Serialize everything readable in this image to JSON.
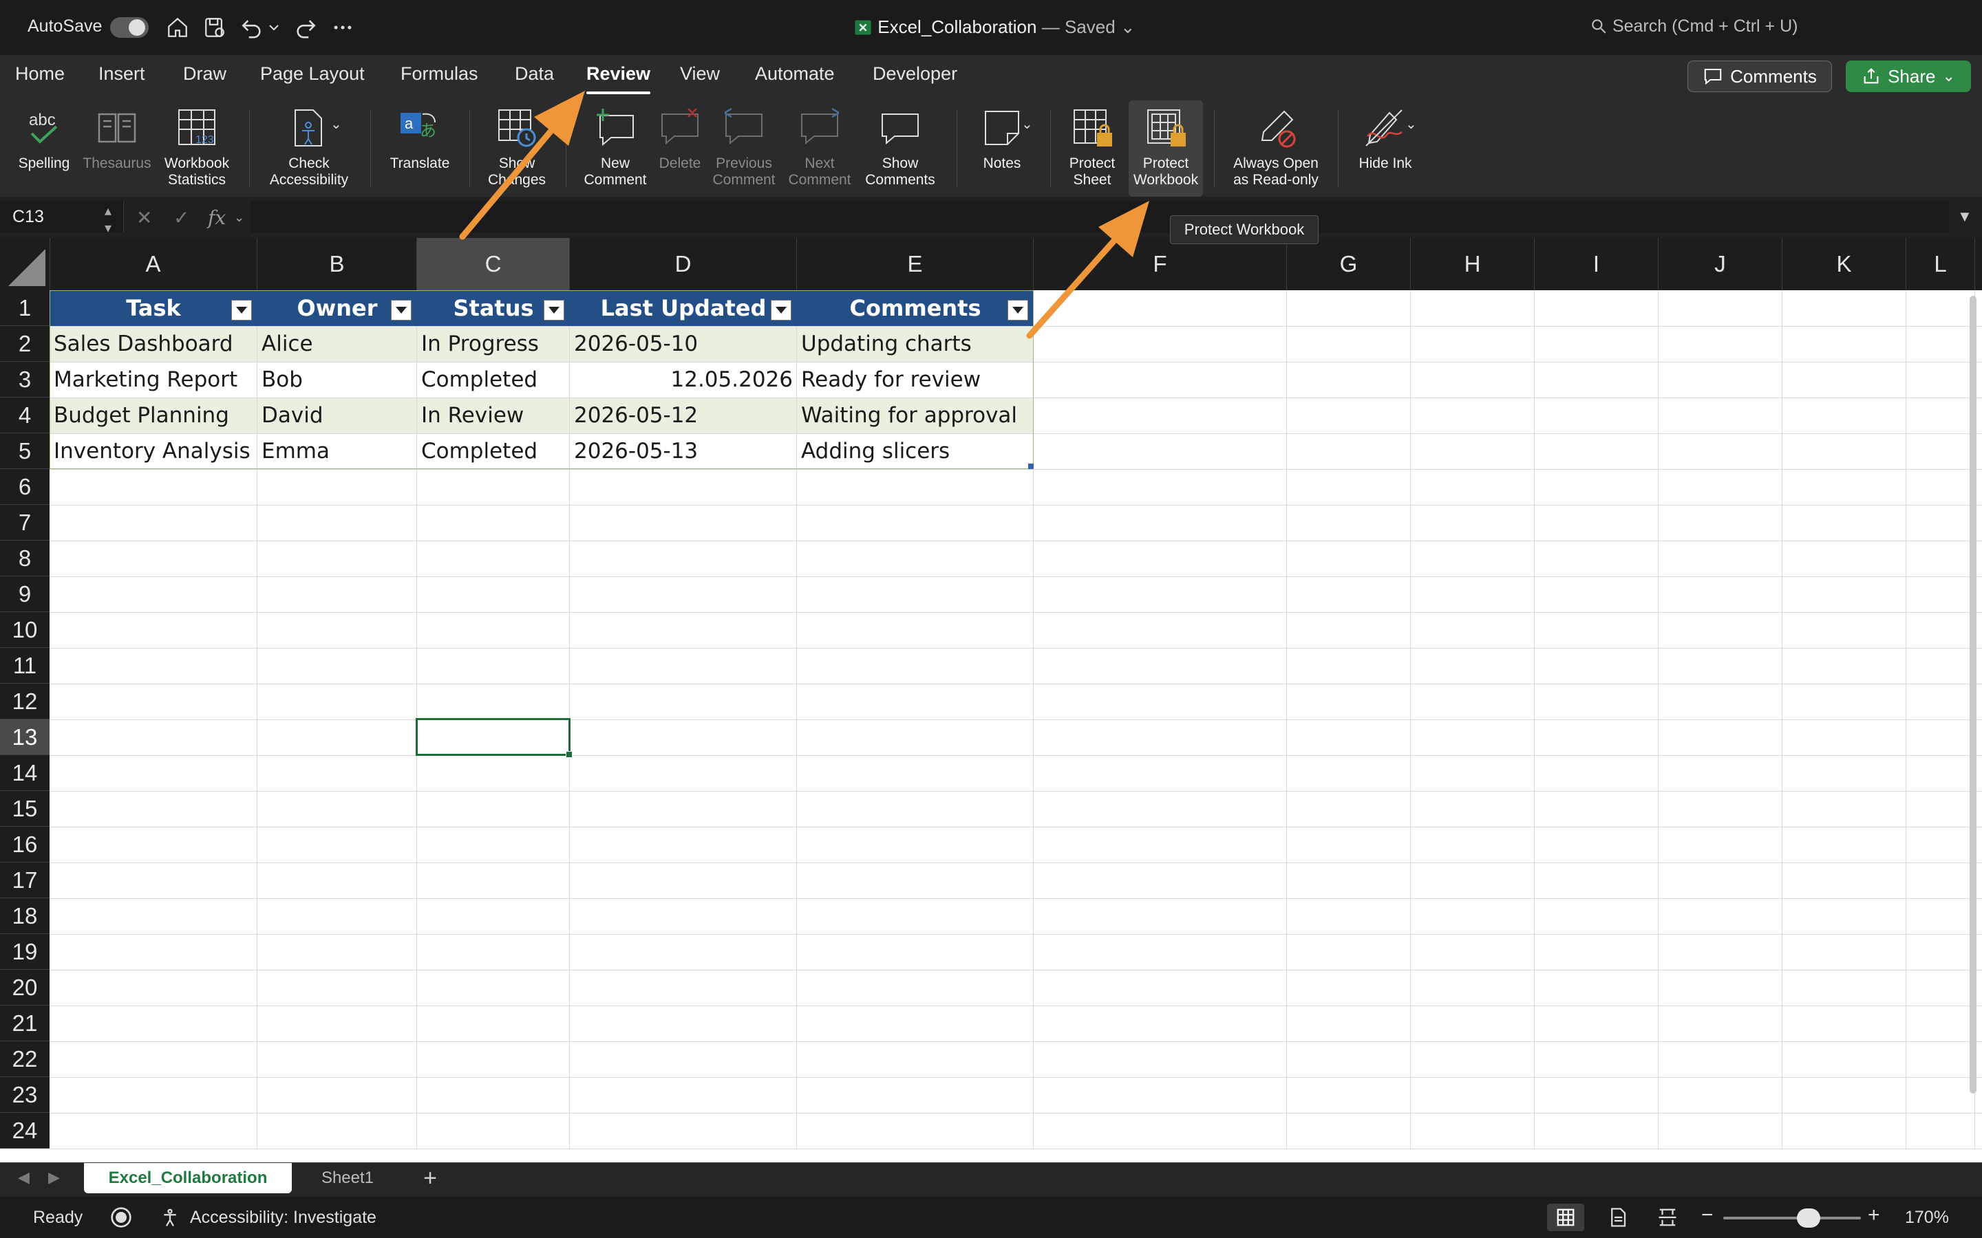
{
  "titlebar": {
    "autosave_label": "AutoSave",
    "doc_title": "Excel_Collaboration",
    "doc_status": "— Saved",
    "search_placeholder": "Search (Cmd + Ctrl + U)"
  },
  "ribbon_tabs": [
    "Home",
    "Insert",
    "Draw",
    "Page Layout",
    "Formulas",
    "Data",
    "Review",
    "View",
    "Automate",
    "Developer"
  ],
  "active_tab": "Review",
  "header_buttons": {
    "comments": "Comments",
    "share": "Share"
  },
  "ribbon": {
    "spelling": "Spelling",
    "thesaurus": "Thesaurus",
    "workbook_statistics": "Workbook\nStatistics",
    "check_accessibility": "Check\nAccessibility",
    "translate": "Translate",
    "show_changes": "Show\nChanges",
    "new_comment": "New\nComment",
    "delete": "Delete",
    "previous_comment": "Previous\nComment",
    "next_comment": "Next\nComment",
    "show_comments": "Show\nComments",
    "notes": "Notes",
    "protect_sheet": "Protect\nSheet",
    "protect_workbook": "Protect\nWorkbook",
    "always_open_readonly": "Always Open\nas Read-only",
    "hide_ink": "Hide Ink"
  },
  "formula_bar": {
    "name_box": "C13",
    "fx": "fx",
    "formula": ""
  },
  "columns": [
    "A",
    "B",
    "C",
    "D",
    "E",
    "F",
    "G",
    "H",
    "I",
    "J",
    "K",
    "L"
  ],
  "selected_column": "C",
  "rows": [
    "1",
    "2",
    "3",
    "4",
    "5",
    "6",
    "7",
    "8",
    "9",
    "10",
    "11",
    "12",
    "13",
    "14",
    "15",
    "16",
    "17",
    "18",
    "19",
    "20",
    "21",
    "22",
    "23",
    "24"
  ],
  "selected_row": "13",
  "table": {
    "headers": [
      "Task",
      "Owner",
      "Status",
      "Last Updated",
      "Comments"
    ],
    "rows": [
      [
        "Sales Dashboard",
        "Alice",
        "In Progress",
        "2026-05-10",
        "Updating charts"
      ],
      [
        "Marketing Report",
        "Bob",
        "Completed",
        "12.05.2026",
        "Ready for review"
      ],
      [
        "Budget Planning",
        "David",
        "In Review",
        "2026-05-12",
        "Waiting for approval"
      ],
      [
        "Inventory Analysis",
        "Emma",
        "Completed",
        "2026-05-13",
        "Adding slicers"
      ]
    ]
  },
  "tooltip": "Protect Workbook",
  "sheets": {
    "active": "Excel_Collaboration",
    "other": "Sheet1",
    "add": "+"
  },
  "status": {
    "ready": "Ready",
    "accessibility": "Accessibility: Investigate",
    "zoom": "170%",
    "zoom_level": 0.62
  },
  "colors": {
    "accent_arrow": "#F0963A",
    "table_header": "#244F86",
    "band": "#E9F0DF",
    "share": "#2F8A45"
  }
}
